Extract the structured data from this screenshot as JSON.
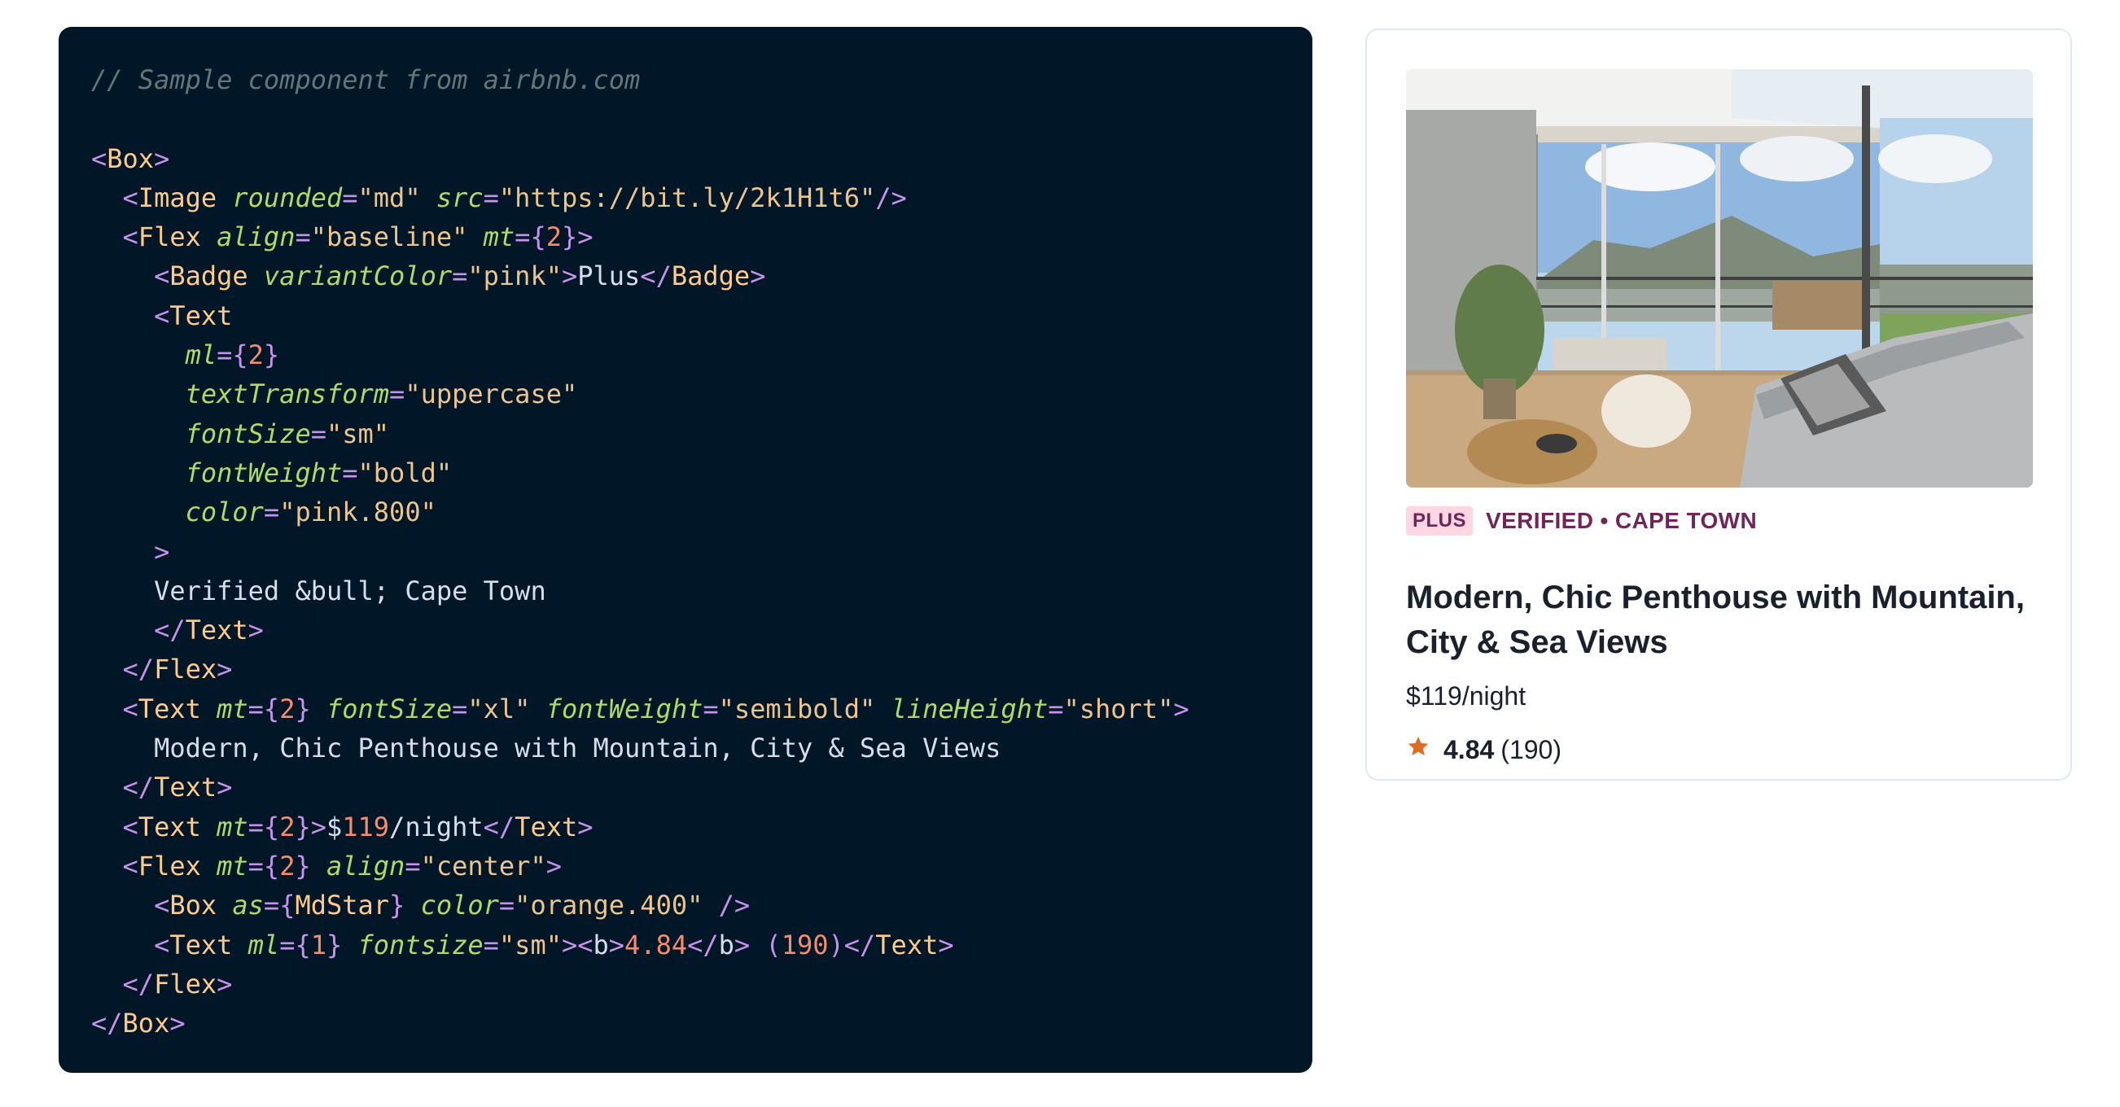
{
  "code": {
    "comment": "// Sample component from airbnb.com",
    "text_verified": "Verified &bull; Cape Town",
    "text_title": "Modern, Chic Penthouse with Mountain, City & Sea Views",
    "image_src": "\"https://bit.ly/2k1H1t6\"",
    "colors": {
      "background": "#011627",
      "comment": "#637777",
      "punctuation": "#c792ea",
      "tag": "#ffcb8b",
      "attribute": "#addb67",
      "string": "#ecc48d",
      "number": "#f78c6c",
      "text": "#d6deeb",
      "keyword": "#7fdbca"
    }
  },
  "card": {
    "badge": "PLUS",
    "location": "VERIFIED • CAPE TOWN",
    "title": "Modern, Chic Penthouse with Mountain, City & Sea Views",
    "price": "$119/night",
    "rating": "4.84",
    "reviews": "(190)",
    "icons": {
      "star": "star-icon"
    },
    "colors": {
      "badge_bg": "#fed7e2",
      "badge_text": "#702459",
      "star": "#dd6b20",
      "title": "#1a202c"
    }
  }
}
